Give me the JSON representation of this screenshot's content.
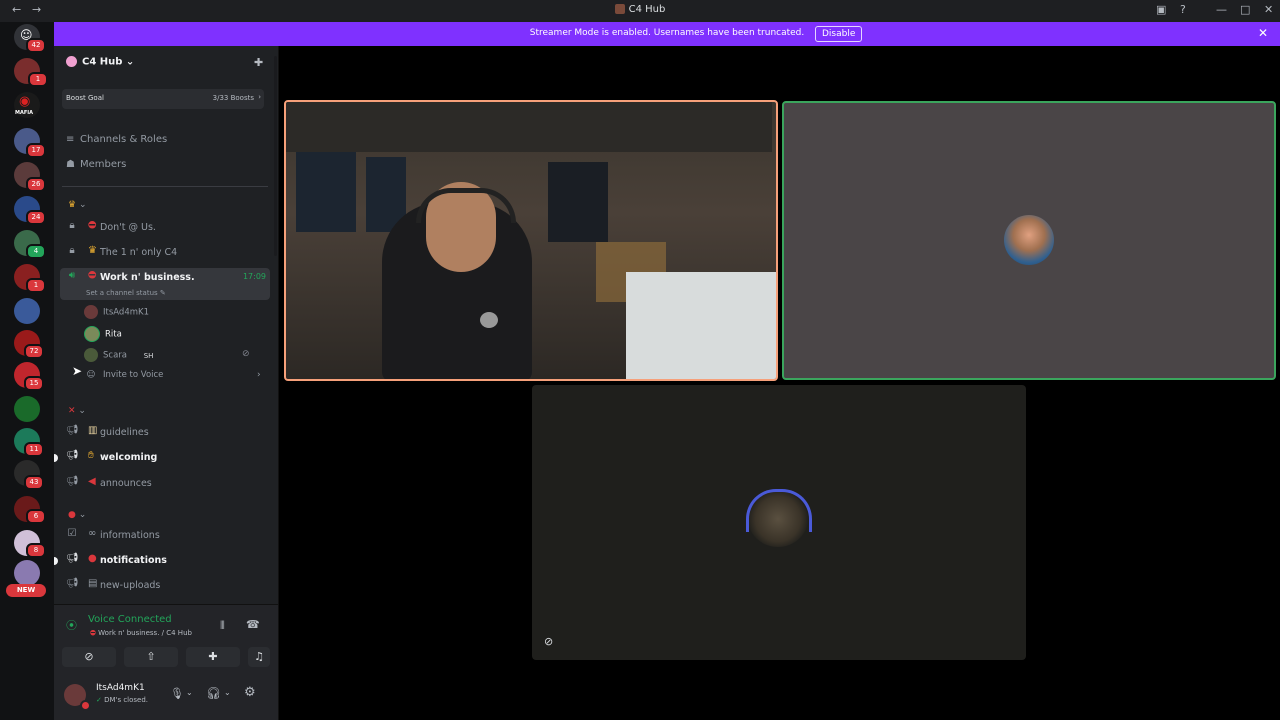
{
  "window": {
    "title": "C4 Hub"
  },
  "banner": {
    "message": "Streamer Mode is enabled. Usernames have been truncated.",
    "disable_label": "Disable"
  },
  "rail": {
    "badges": [
      "42",
      "1",
      "17",
      "26",
      "24",
      "4",
      "1",
      "72",
      "15",
      "11",
      "43",
      "6",
      "8"
    ],
    "new_label": "NEW",
    "mafia_label": "MAFIA"
  },
  "server": {
    "name": "C4 Hub"
  },
  "boost": {
    "label": "Boost Goal",
    "progress": "3/33 Boosts"
  },
  "nav": {
    "channels_roles": "Channels & Roles",
    "members": "Members"
  },
  "channels": {
    "dont_at_us": "Don't @ Us.",
    "the_one": "The 1 n' only C4",
    "work": "Work n' business.",
    "work_time": "17:09",
    "status_hint": "Set a channel status",
    "guidelines": "guidelines",
    "welcoming": "welcoming",
    "announces": "announces",
    "informations": "informations",
    "notifications": "notifications",
    "new_uploads": "new-uploads"
  },
  "members": [
    {
      "name": "ItsAd4mK1"
    },
    {
      "name": "Rita"
    },
    {
      "name": "Scara",
      "tag": "SH"
    }
  ],
  "invite": "Invite to Voice",
  "voice": {
    "status": "Voice Connected",
    "location": "Work n' business. / C4 Hub"
  },
  "user": {
    "name": "ItsAd4mK1",
    "status": "DM's closed."
  },
  "colors": {
    "banner": "#7f31ff",
    "voice_green": "#23a55a",
    "speaking_border": "#3ba55d",
    "tile_orange_border": "#f6a07a"
  }
}
